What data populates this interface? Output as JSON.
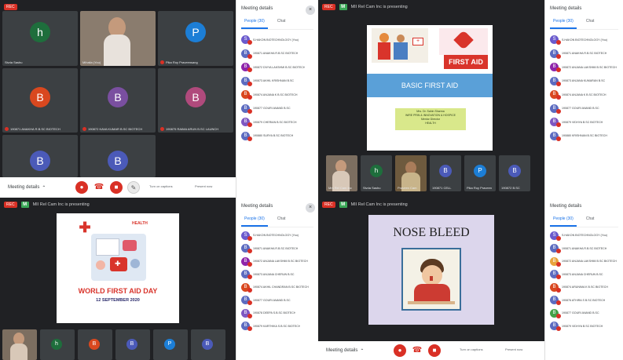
{
  "colors": {
    "meet_dark": "#202124",
    "tile": "#3c4043",
    "mic_red": "#d93025",
    "meet_blue": "#1a73e8",
    "slide_blue": "#5aa0d8",
    "first_aid_red": "#d9342b"
  },
  "common": {
    "rec_label": "REC",
    "meeting_details": "Meeting details",
    "panel_title": "Meeting details",
    "tab_people": "People (30)",
    "tab_chat": "Chat",
    "presenting_text": "MII Rel Cam Inc is presenting"
  },
  "q1": {
    "tiles": [
      {
        "initial": "h",
        "color": "#1e6e3c",
        "name": "Sivda Sashu"
      },
      {
        "initial": "",
        "color": "",
        "name": "Mihaila (You)"
      },
      {
        "initial": "P",
        "color": "#1c7ed6",
        "name": "Pika Roy Praveensang"
      },
      {
        "initial": "B",
        "color": "#d9481f",
        "name": "190871 ANAKHA R.B.SC BIOTECH"
      },
      {
        "initial": "B",
        "color": "#7a4fa0",
        "name": "190872 KAVA KUMAR B.SC BIOTECH"
      },
      {
        "initial": "B",
        "color": "#b04a7c",
        "name": "190875 RAIMA ARUN B.SC LAUNCH"
      },
      {
        "initial": "B",
        "color": "#4b5ab8",
        "name": ""
      },
      {
        "initial": "B",
        "color": "#4b5ab8",
        "name": ""
      }
    ],
    "people": [
      "S.HAKON BIOTECHNOLOGY (You)",
      "190871 ANAKHA R.B.SC BIOTECH",
      "190872 DIVYA LAKSHMI B.SC BIOTECH",
      "190873 AKHIL KRISHNAN B.SC",
      "190874 ANJANA K B.SC BIOTECH",
      "190877 GOURI ANAND B.SC",
      "190879 CHERIAN B.SC BIOTECH",
      "190880 SURYA B.SC BIOTECH"
    ],
    "bottom_labels": [
      "Turn on captions",
      "Present now"
    ]
  },
  "q2": {
    "slide_title": "BASIC FIRST AID",
    "first_aid_label": "FIRST AID",
    "author_lines": [
      "Mrs. Dr. Sahin Sharma",
      "WIRE PRIN & INNOVATION & HOSPICE",
      "Mentor Director",
      "HEALTH"
    ],
    "strip_tiles": [
      {
        "initial": "",
        "name": "Mrs Rel Cam Inc"
      },
      {
        "initial": "h",
        "name": "Sivda Sashu"
      },
      {
        "initial": "",
        "name": "Praveen Cam"
      },
      {
        "initial": "B",
        "name": "190871 CELL"
      },
      {
        "initial": "P",
        "name": "Pika Roy Praveen"
      },
      {
        "initial": "B",
        "name": "190872 B.SC"
      }
    ],
    "people": [
      "S.HAKON BIOTECHNOLOGY (You)",
      "190871 ANAKHA R.B.SC BIOTECH",
      "190872 ANJANA LAKSHMI B.SC BIOTECH",
      "190873 ANJANA KUMARAN B.SC",
      "190874 ANJANA K B.SC BIOTECH",
      "190877 GOURI ANAND B.SC",
      "190879 VIDHYA B.SC BIOTECH",
      "190880 KRISHNAN B.SC BIOTECH"
    ]
  },
  "q3": {
    "wfad_line1": "WORLD FIRST AID DAY",
    "wfad_line2": "12 SEPTEMBER 2020",
    "health_label": "HEALTH",
    "people": [
      "S.HAKON BIOTECHNOLOGY (You)",
      "190871 ANAKHA R.B.SC BIOTECH",
      "190872 ANJANA LAKSHMI B.SC BIOTECH",
      "190873 ANJANA CHERUN B.SC",
      "190874 AKHIL CHANDRAN B.SC BIOTECH",
      "190877 GOURI ANAND B.SC",
      "190878 DEEPA S.B.SC BIOTECH",
      "190879 KARTHIKA S.B.SC BIOTECH"
    ]
  },
  "q4": {
    "slide_title": "NOSE BLEED",
    "bottom_labels": [
      "Turn on captions",
      "Present now"
    ],
    "people": [
      "S.HAKON BIOTECHNOLOGY (You)",
      "190871 ANAKHA R.B.SC BIOTECH",
      "190872 ANJANA LAKSHMI B.SC BIOTECH",
      "190873 ANJANA CHERUN B.SC",
      "190874 ARUNIMA K B.SC BIOTECH",
      "190876 ATHIRA S B.SC BIOTECH",
      "190877 GOURI ANAND B.SC",
      "190879 VIDHYA B.SC BIOTECH"
    ]
  }
}
